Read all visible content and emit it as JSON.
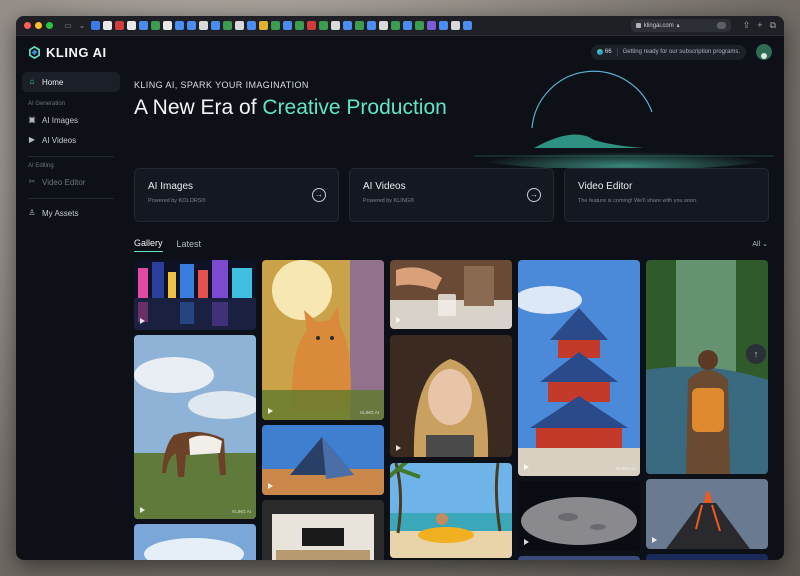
{
  "browser": {
    "url": "klingai.com",
    "tab_colors": [
      "#3b7be8",
      "#e8e8e8",
      "#d23b3b",
      "#e8e8e8",
      "#4a8cf0",
      "#3c9c4f",
      "#e8e8e8",
      "#4a8cf0",
      "#4a8cf0",
      "#d9d9d9",
      "#4a8cf0",
      "#3c9c4f",
      "#d9d9d9",
      "#4a8cf0",
      "#e0b030",
      "#3c9c4f",
      "#4a8cf0",
      "#3c9c4f",
      "#d23b3b",
      "#3c9c4f",
      "#d9d9d9",
      "#4a8cf0",
      "#3c9c4f",
      "#4a8cf0",
      "#d9d9d9",
      "#3c9c4f",
      "#4a8cf0",
      "#3c9c4f",
      "#7b5cd6",
      "#4a8cf0",
      "#d9d9d9",
      "#4a8cf0"
    ]
  },
  "header": {
    "logo_text": "KLING AI",
    "credits": "66",
    "notice": "Getting ready for our subscription programs."
  },
  "sidebar": {
    "home": "Home",
    "section_generation": "AI Generation",
    "ai_images": "AI Images",
    "ai_videos": "AI Videos",
    "section_editing": "AI Editing",
    "video_editor": "Video Editor",
    "my_assets": "My Assets"
  },
  "hero": {
    "kicker": "KLING AI, SPARK YOUR IMAGINATION",
    "headline_prefix": "A New Era of ",
    "headline_accent": "Creative Production"
  },
  "cards": [
    {
      "title": "AI Images",
      "sub": "Powered by KOLORS®"
    },
    {
      "title": "AI Videos",
      "sub": "Powered by KLING®"
    },
    {
      "title": "Video Editor",
      "sub": "The feature is coming! We'll share with you soon."
    }
  ],
  "gallery_tabs": {
    "gallery": "Gallery",
    "latest": "Latest"
  },
  "filter": "All",
  "watermark": "KLING AI",
  "colors": {
    "accent": "#5fe6c7",
    "bg": "#0d1016",
    "card": "#141820"
  }
}
